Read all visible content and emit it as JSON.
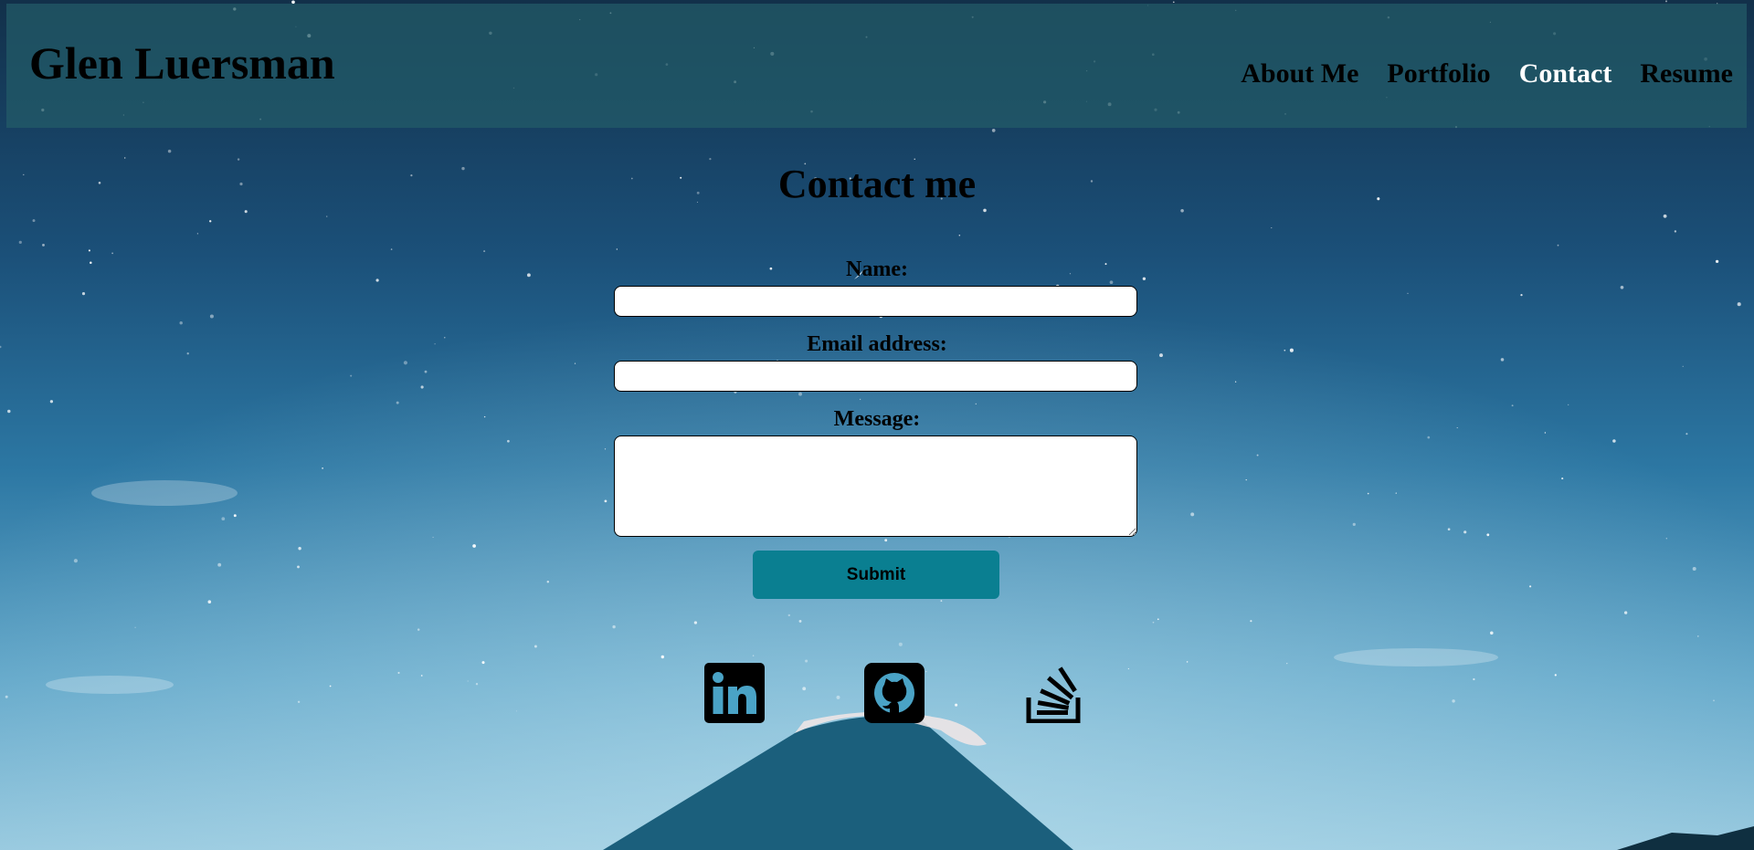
{
  "header": {
    "site_title": "Glen Luersman",
    "nav": [
      {
        "label": "About Me",
        "active": false
      },
      {
        "label": "Portfolio",
        "active": false
      },
      {
        "label": "Contact",
        "active": true
      },
      {
        "label": "Resume",
        "active": false
      }
    ]
  },
  "contact": {
    "heading": "Contact me",
    "name_label": "Name:",
    "name_value": "",
    "email_label": "Email address:",
    "email_value": "",
    "message_label": "Message:",
    "message_value": "",
    "submit_label": "Submit"
  },
  "social": [
    {
      "name": "linkedin-icon"
    },
    {
      "name": "github-icon"
    },
    {
      "name": "stackoverflow-icon"
    }
  ],
  "colors": {
    "header_overlay": "#225c68",
    "active_nav": "#ffffff",
    "submit_bg": "#0a7f91"
  }
}
